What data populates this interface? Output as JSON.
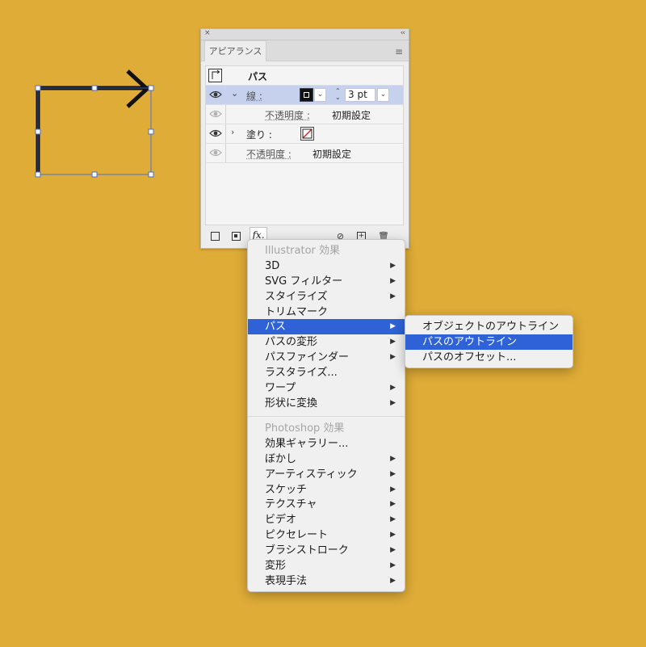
{
  "panel": {
    "tab_label": "アピアランス",
    "close_glyph": "×",
    "collapse_glyph": "‹‹",
    "menu_glyph": "≡",
    "object_title": "パス",
    "stroke": {
      "label": "線 :",
      "weight": "3 pt"
    },
    "stroke_opacity": {
      "label": "不透明度 :",
      "value": "初期設定"
    },
    "fill": {
      "label": "塗り :"
    },
    "opacity": {
      "label": "不透明度 :",
      "value": "初期設定"
    },
    "fx_label": "fx."
  },
  "effects_menu": {
    "illustrator_header": "Illustrator 効果",
    "items_illustrator": [
      {
        "label": "3D",
        "submenu": true
      },
      {
        "label": "SVG フィルター",
        "submenu": true
      },
      {
        "label": "スタイライズ",
        "submenu": true
      },
      {
        "label": "トリムマーク",
        "submenu": false
      },
      {
        "label": "パス",
        "submenu": true,
        "highlighted": true
      },
      {
        "label": "パスの変形",
        "submenu": true
      },
      {
        "label": "パスファインダー",
        "submenu": true
      },
      {
        "label": "ラスタライズ...",
        "submenu": false
      },
      {
        "label": "ワープ",
        "submenu": true
      },
      {
        "label": "形状に変換",
        "submenu": true
      }
    ],
    "photoshop_header": "Photoshop 効果",
    "items_photoshop": [
      {
        "label": "効果ギャラリー...",
        "submenu": false
      },
      {
        "label": "ぼかし",
        "submenu": true
      },
      {
        "label": "アーティスティック",
        "submenu": true
      },
      {
        "label": "スケッチ",
        "submenu": true
      },
      {
        "label": "テクスチャ",
        "submenu": true
      },
      {
        "label": "ビデオ",
        "submenu": true
      },
      {
        "label": "ピクセレート",
        "submenu": true
      },
      {
        "label": "ブラシストローク",
        "submenu": true
      },
      {
        "label": "変形",
        "submenu": true
      },
      {
        "label": "表現手法",
        "submenu": true
      }
    ]
  },
  "path_submenu": {
    "items": [
      {
        "label": "オブジェクトのアウトライン",
        "highlighted": false
      },
      {
        "label": "パスのアウトライン",
        "highlighted": true
      },
      {
        "label": "パスのオフセット...",
        "highlighted": false
      }
    ]
  },
  "colors": {
    "canvas_bg": "#DFAC37",
    "highlight": "#2E62D6",
    "selection_row": "#C6D2ED",
    "selection_bbox": "#4A6FD1",
    "stroke": "#111111"
  }
}
